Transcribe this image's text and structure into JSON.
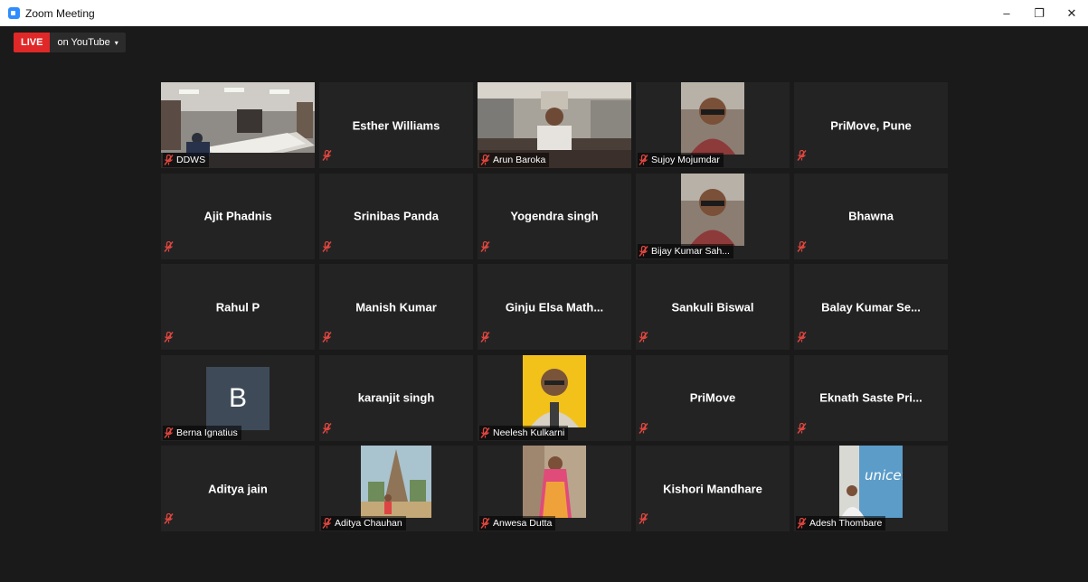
{
  "window": {
    "title": "Zoom Meeting"
  },
  "window_controls": {
    "minimize": "–",
    "maximize": "❐",
    "close": "✕"
  },
  "live": {
    "badge": "LIVE",
    "destination": "on YouTube",
    "caret": "▾"
  },
  "colors": {
    "live_red": "#e02828",
    "tile_bg": "#232323",
    "mute_red": "#e0463f"
  },
  "participants": [
    {
      "name": "DDWS",
      "video": "room"
    },
    {
      "name": "Esther Williams"
    },
    {
      "name": "Arun Baroka",
      "video": "office"
    },
    {
      "name": "Sujoy Mojumdar",
      "photo": "portrait"
    },
    {
      "name": "PriMove, Pune"
    },
    {
      "name": "Ajit Phadnis"
    },
    {
      "name": "Srinibas Panda"
    },
    {
      "name": "Yogendra singh"
    },
    {
      "name": "Bijay Kumar Sah...",
      "photo": "portrait"
    },
    {
      "name": "Bhawna"
    },
    {
      "name": "Rahul P"
    },
    {
      "name": "Manish Kumar"
    },
    {
      "name": "Ginju Elsa Math..."
    },
    {
      "name": "Sankuli Biswal"
    },
    {
      "name": "Balay Kumar Se..."
    },
    {
      "name": "Berna Ignatius",
      "avatar": "B"
    },
    {
      "name": "karanjit singh"
    },
    {
      "name": "Neelesh Kulkarni",
      "photo": "yellow"
    },
    {
      "name": "PriMove"
    },
    {
      "name": "Eknath Saste Pri..."
    },
    {
      "name": "Aditya jain"
    },
    {
      "name": "Aditya Chauhan",
      "photo": "temple"
    },
    {
      "name": "Anwesa Dutta",
      "photo": "saree"
    },
    {
      "name": "Kishori Mandhare"
    },
    {
      "name": "Adesh Thombare",
      "photo": "unicef"
    }
  ]
}
